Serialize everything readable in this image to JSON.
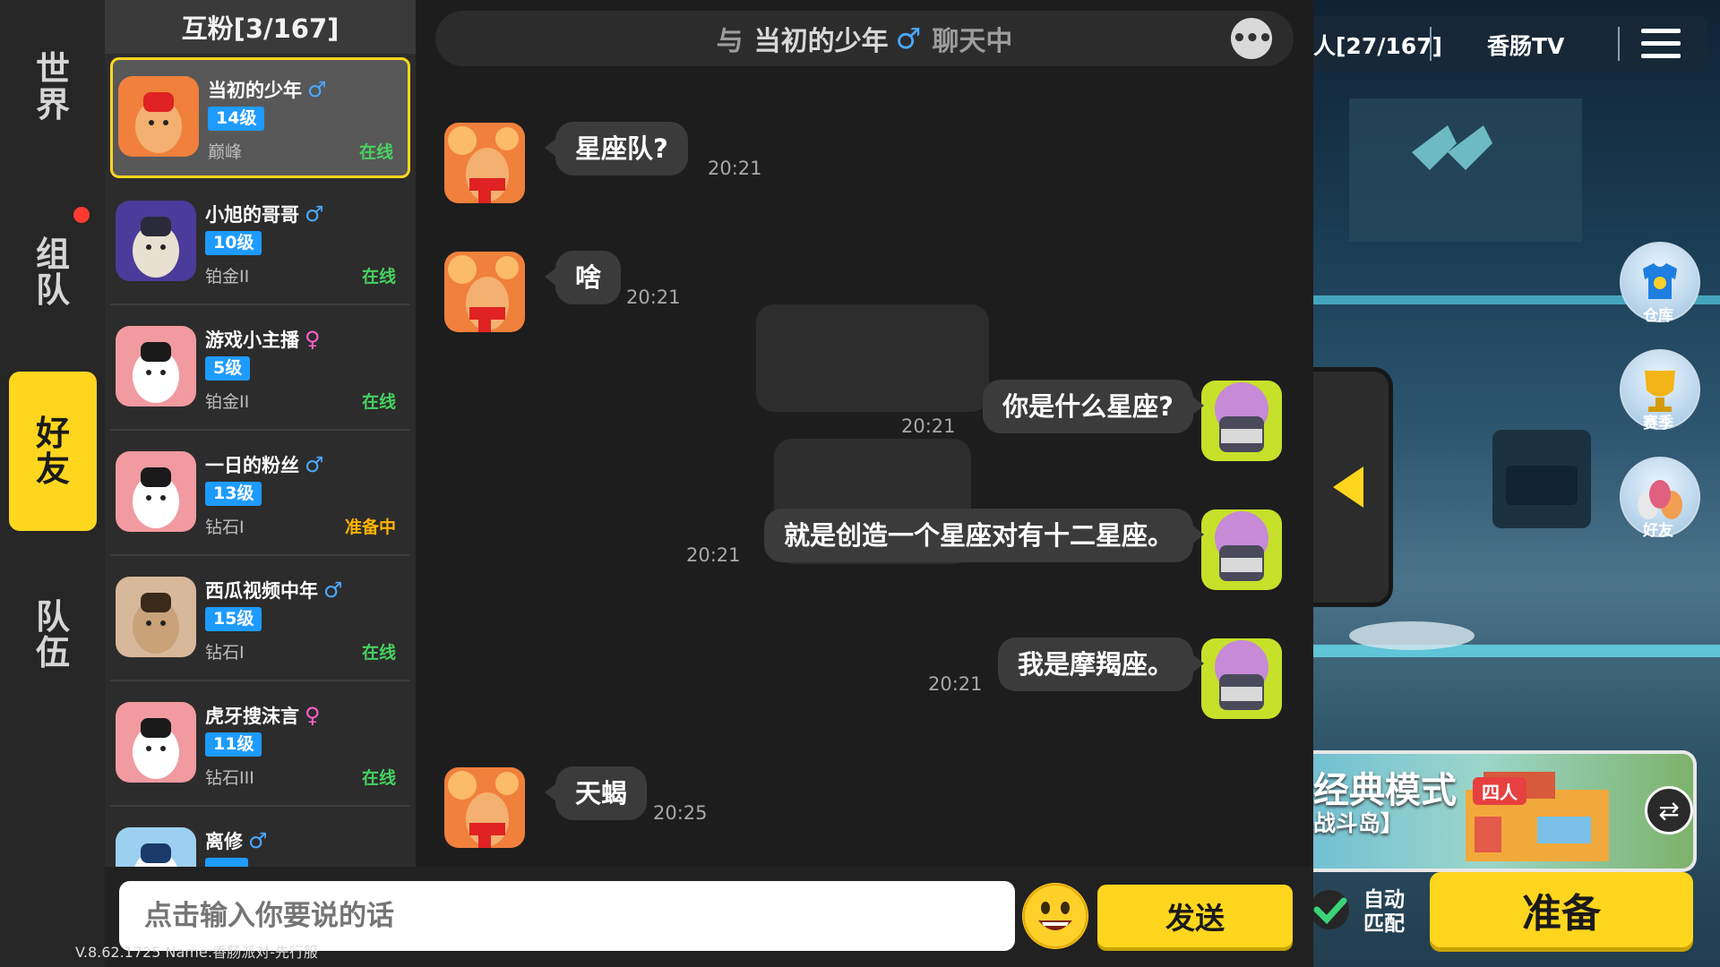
{
  "nav": {
    "tabs": [
      {
        "label": "世界",
        "active": false
      },
      {
        "label": "组队",
        "active": false,
        "has_notification": true
      },
      {
        "label": "好友",
        "active": true
      },
      {
        "label": "队伍",
        "active": false
      }
    ]
  },
  "friends_panel": {
    "title": "互粉[3/167]",
    "friends": [
      {
        "name": "当初的少年",
        "gender": "male",
        "gender_symbol": "♂",
        "level": "14级",
        "rank": "巅峰",
        "status": "在线",
        "selected": true
      },
      {
        "name": "小旭的哥哥",
        "gender": "male",
        "gender_symbol": "♂",
        "level": "10级",
        "rank": "铂金II",
        "status": "在线"
      },
      {
        "name": "游戏小主播",
        "gender": "female",
        "gender_symbol": "♀",
        "level": "5级",
        "rank": "铂金II",
        "status": "在线"
      },
      {
        "name": "一日的粉丝",
        "gender": "male",
        "gender_symbol": "♂",
        "level": "13级",
        "rank": "钻石I",
        "status": "准备中"
      },
      {
        "name": "西瓜视频中年",
        "gender": "male",
        "gender_symbol": "♂",
        "level": "15级",
        "rank": "钻石I",
        "status": "在线"
      },
      {
        "name": "虎牙搜沫言",
        "gender": "female",
        "gender_symbol": "♀",
        "level": "11级",
        "rank": "钻石III",
        "status": "在线"
      },
      {
        "name": "离修",
        "gender": "male",
        "gender_symbol": "♂",
        "level": "",
        "rank": "",
        "status": ""
      }
    ]
  },
  "chat": {
    "header_prefix": "与",
    "header_name": "当初的少年",
    "header_gender_symbol": "♂",
    "header_suffix": "聊天中",
    "more_icon": "ellipsis-icon",
    "messages": [
      {
        "side": "left",
        "text": "星座队?",
        "time": "20:21"
      },
      {
        "side": "left",
        "text": "啥",
        "time": "20:21"
      },
      {
        "side": "right",
        "text": "你是什么星座?",
        "time": "20:21"
      },
      {
        "side": "right",
        "text": "就是创造一个星座对有十二星座。",
        "time": "20:21"
      },
      {
        "side": "right",
        "text": "我是摩羯座。",
        "time": "20:21"
      },
      {
        "side": "left",
        "text": "天蝎",
        "time": "20:25"
      }
    ],
    "input_placeholder": "点击输入你要说的话",
    "send_label": "发送",
    "emoji_icon": "smiley-emoji-icon"
  },
  "version_text": "V.8.62.1725 Name:香肠派对-先行服",
  "game": {
    "top_count": "人[27/167]",
    "top_channel": "香肠TV",
    "menu_icon": "hamburger-menu-icon",
    "side_buttons": [
      {
        "label": "仓库",
        "icon": "tshirt-icon"
      },
      {
        "label": "赛季",
        "icon": "trophy-icon"
      },
      {
        "label": "好友",
        "icon": "friends-icon"
      }
    ],
    "mode_title": "经典模式",
    "mode_badge": "四人",
    "mode_map": "战斗岛】",
    "auto_match_label_1": "自动",
    "auto_match_label_2": "匹配",
    "auto_match_checked": true,
    "ready_label": "准备"
  },
  "colors": {
    "accent": "#ffd61e",
    "online": "#47d160",
    "ready": "#ffb400",
    "level_badge": "#1e9bff",
    "male": "#4aa8ff",
    "female": "#ff5fc8"
  }
}
